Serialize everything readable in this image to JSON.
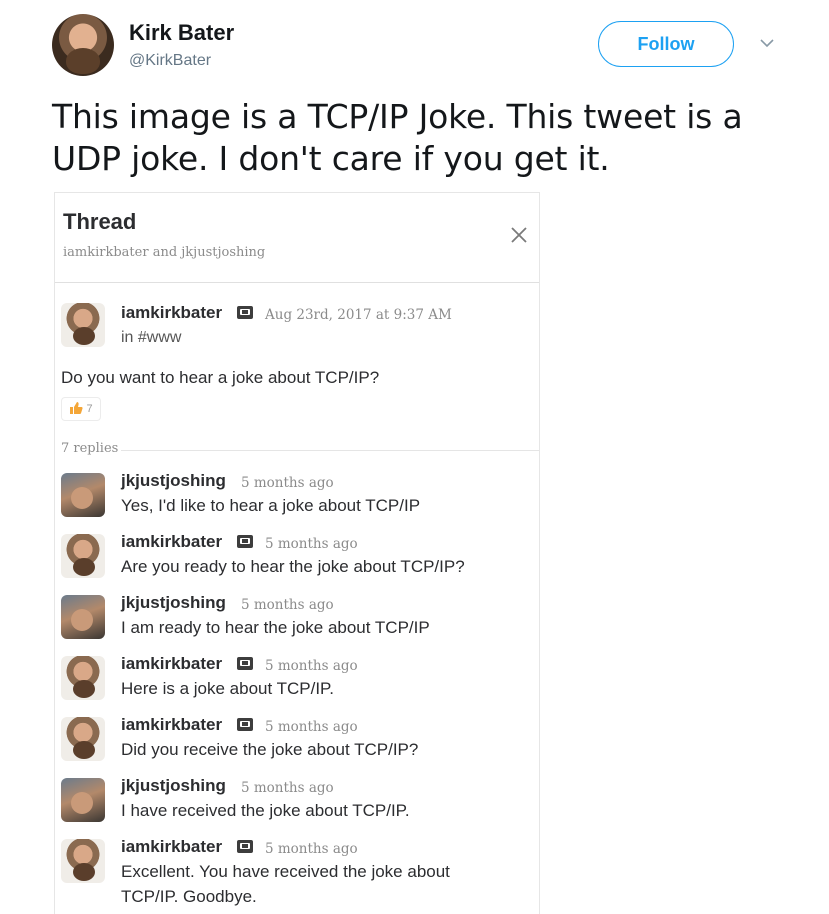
{
  "tweet": {
    "author_name": "Kirk Bater",
    "author_handle": "@KirkBater",
    "follow_label": "Follow",
    "text": "This image is a TCP/IP Joke.  This tweet is a UDP joke.  I don't care if you get it."
  },
  "thread": {
    "title": "Thread",
    "subtitle": "iamkirkbater and jkjustjoshing",
    "parent": {
      "author": "iamkirkbater",
      "timestamp": "Aug 23rd, 2017 at 9:37 AM",
      "channel": "in #www",
      "text": "Do you want to hear a joke about TCP/IP?",
      "reaction_emoji": "thumbs-up",
      "reaction_count": "7"
    },
    "replies_label": "7 replies",
    "replies": [
      {
        "author": "jkjustjoshing",
        "time": "5 months ago",
        "text": "Yes, I'd like to hear a joke about TCP/IP",
        "bot": false
      },
      {
        "author": "iamkirkbater",
        "time": "5 months ago",
        "text": "Are you ready to hear the joke about TCP/IP?",
        "bot": true
      },
      {
        "author": "jkjustjoshing",
        "time": "5 months ago",
        "text": "I am ready to hear the joke about TCP/IP",
        "bot": false
      },
      {
        "author": "iamkirkbater",
        "time": "5 months ago",
        "text": "Here is a joke about TCP/IP.",
        "bot": true
      },
      {
        "author": "iamkirkbater",
        "time": "5 months ago",
        "text": "Did you receive the joke about TCP/IP?",
        "bot": true
      },
      {
        "author": "jkjustjoshing",
        "time": "5 months ago",
        "text": "I have received the joke about TCP/IP.",
        "bot": false
      },
      {
        "author": "iamkirkbater",
        "time": "5 months ago",
        "text": "Excellent.  You have received the joke about TCP/IP.  Goodbye.",
        "bot": true
      }
    ]
  },
  "icons": {
    "caret": "chevron-down-icon",
    "close": "close-icon",
    "reaction": "thumbs-up-icon",
    "bot": "bot-badge-icon"
  },
  "colors": {
    "twitter_blue": "#1da1f2",
    "text_dark": "#14171a",
    "muted": "#657786"
  }
}
